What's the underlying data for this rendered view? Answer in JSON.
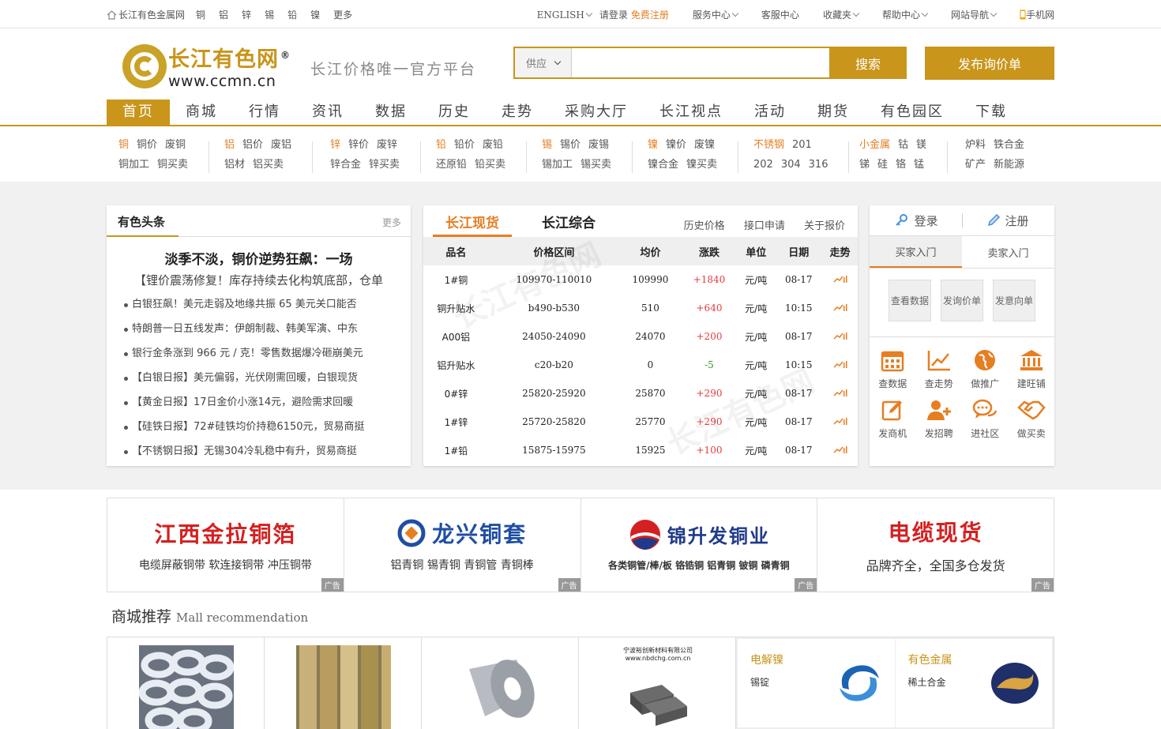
{
  "topbar": {
    "site_name": "长江有色金属网",
    "metals": [
      "铜",
      "铝",
      "锌",
      "锡",
      "铅",
      "镍",
      "更多"
    ],
    "english": "ENGLISH",
    "login_prompt": "请登录",
    "register": "免费注册",
    "links": [
      "服务中心",
      "客服中心",
      "收藏夹",
      "帮助中心",
      "网站导航",
      "手机网"
    ]
  },
  "header": {
    "logo_cn": "长江有色网",
    "logo_en": "www.ccmn.cn",
    "logo_reg": "®",
    "slogan": "长江价格唯一官方平台",
    "search_select": "供应",
    "search_value": "",
    "search_button": "搜索",
    "publish_button": "发布询价单"
  },
  "nav": [
    "首页",
    "商城",
    "行情",
    "资讯",
    "数据",
    "历史",
    "走势",
    "采购大厅",
    "长江视点",
    "活动",
    "期货",
    "有色园区",
    "下载"
  ],
  "metal_groups": [
    {
      "row1": [
        "铜",
        "铜价",
        "废铜"
      ],
      "row2": [
        "铜加工",
        "铜买卖"
      ]
    },
    {
      "row1": [
        "铝",
        "铝价",
        "废铝"
      ],
      "row2": [
        "铝材",
        "铝买卖"
      ]
    },
    {
      "row1": [
        "锌",
        "锌价",
        "废锌"
      ],
      "row2": [
        "锌合金",
        "锌买卖"
      ]
    },
    {
      "row1": [
        "铅",
        "铅价",
        "废铅"
      ],
      "row2": [
        "还原铅",
        "铅买卖"
      ]
    },
    {
      "row1": [
        "锡",
        "锡价",
        "废锡"
      ],
      "row2": [
        "锡加工",
        "锡买卖"
      ]
    },
    {
      "row1": [
        "镍",
        "镍价",
        "废镍"
      ],
      "row2": [
        "镍合金",
        "镍买卖"
      ]
    },
    {
      "row1": [
        "不锈钢",
        "201"
      ],
      "row2": [
        "202",
        "304",
        "316"
      ]
    },
    {
      "row1": [
        "小金属",
        "钴",
        "镁"
      ],
      "row2": [
        "锑",
        "硅",
        "铬",
        "锰"
      ]
    },
    {
      "row1": [
        "炉料",
        "铁合金"
      ],
      "row2": [
        "矿产",
        "新能源"
      ]
    }
  ],
  "news": {
    "title": "有色头条",
    "more": "更多",
    "headline": "淡季不淡，铜价逆势狂飙：一场",
    "subheadline": "【锂价震荡修复！库存持续去化构筑底部，仓单",
    "items": [
      "白银狂飙！美元走弱及地缘共振 65 美元关口能否",
      "特朗普一日五线发声：伊朗制裁、韩美军演、中东",
      "银行金条涨到 966 元 / 克！零售数据爆冷砸崩美元",
      "【白银日报】美元偏弱，光伏刚需回暖，白银现货",
      "【黄金日报】17日金价小涨14元，避险需求回暖",
      "【硅铁日报】72#硅铁均价持稳6150元，贸易商挺",
      "【不锈钢日报】无锡304冷轧稳中有升，贸易商挺"
    ]
  },
  "price": {
    "tab_active": "长江现货",
    "tab_other": "长江综合",
    "links": [
      "历史价格",
      "接口申请",
      "关于报价"
    ],
    "headers": [
      "品名",
      "价格区间",
      "均价",
      "涨跌",
      "单位",
      "日期",
      "走势"
    ],
    "rows": [
      {
        "name": "1#铜",
        "range": "109970-110010",
        "avg": "109990",
        "chg": "+1840",
        "unit": "元/吨",
        "date": "08-17",
        "dir": "up"
      },
      {
        "name": "铜升贴水",
        "range": "b490-b530",
        "avg": "510",
        "chg": "+640",
        "unit": "元/吨",
        "date": "10:15",
        "dir": "up"
      },
      {
        "name": "A00铝",
        "range": "24050-24090",
        "avg": "24070",
        "chg": "+200",
        "unit": "元/吨",
        "date": "08-17",
        "dir": "up"
      },
      {
        "name": "铝升贴水",
        "range": "c20-b20",
        "avg": "0",
        "chg": "-5",
        "unit": "元/吨",
        "date": "10:15",
        "dir": "down"
      },
      {
        "name": "0#锌",
        "range": "25820-25920",
        "avg": "25870",
        "chg": "+290",
        "unit": "元/吨",
        "date": "08-17",
        "dir": "up"
      },
      {
        "name": "1#锌",
        "range": "25720-25820",
        "avg": "25770",
        "chg": "+290",
        "unit": "元/吨",
        "date": "08-17",
        "dir": "up"
      },
      {
        "name": "1#铅",
        "range": "15875-15975",
        "avg": "15925",
        "chg": "+100",
        "unit": "元/吨",
        "date": "08-17",
        "dir": "up"
      }
    ]
  },
  "user": {
    "login": "登录",
    "register": "注册",
    "tabs": [
      "买家入门",
      "卖家入门"
    ],
    "buttons": [
      [
        "查看",
        "数据"
      ],
      [
        "发询",
        "价单"
      ],
      [
        "发意",
        "向单"
      ]
    ],
    "grid": [
      "查数据",
      "查走势",
      "做推广",
      "建旺铺",
      "发商机",
      "发招聘",
      "进社区",
      "做买卖"
    ]
  },
  "ads": [
    {
      "big": "江西金拉铜箔",
      "small": "电缆屏蔽铜带 软连接铜带 冲压铜带",
      "tag": "广告",
      "color": "#d42020"
    },
    {
      "big": "龙兴铜套",
      "small": "铝青铜 锡青铜 青铜管 青铜棒",
      "tag": "广告",
      "color": "#1f4ea3"
    },
    {
      "big": "锦升发铜业",
      "small": "各类铜管/棒/板 铬锆铜 铝青铜 铍铜 磷青铜",
      "tag": "广告",
      "color": "#1f3a8a"
    },
    {
      "big": "电缆现货",
      "small": "品牌齐全，全国多仓发货",
      "tag": "广告",
      "color": "#d42020"
    }
  ],
  "mall": {
    "title": "商城推荐",
    "subtitle": "Mall recommendation",
    "product_caption": "宁波裕创新材料有限公司",
    "product_url": "www.nbdchg.com.cn",
    "cards": [
      {
        "title": "电解镍",
        "sub": "锡锭"
      },
      {
        "title": "有色金属",
        "sub": "稀土合金"
      }
    ]
  },
  "colors": {
    "gold": "#c9951a",
    "orange": "#e67e22",
    "up": "#e63b3b",
    "down": "#2a9a2a"
  }
}
